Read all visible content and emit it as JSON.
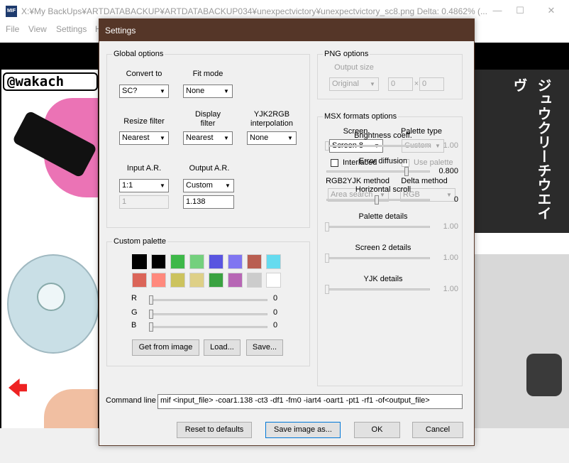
{
  "window": {
    "icon": "MIF",
    "title": "X:¥My BackUps¥ARTDATABACKUP¥ARTDATABACKUP034¥unexpectvictory¥unexpectvictory_sc8.png  Delta: 0.4862% (..."
  },
  "menu": [
    "File",
    "View",
    "Settings",
    "H"
  ],
  "image_overlay": {
    "handle": "@wakach",
    "jp_right": "ジュウクリーチウエイヴ"
  },
  "dialog": {
    "title": "Settings",
    "global": {
      "group_label": "Global options",
      "convert_to": {
        "label": "Convert to",
        "value": "SC?"
      },
      "fit_mode": {
        "label": "Fit mode",
        "value": "None"
      },
      "resize_filter": {
        "label": "Resize filter",
        "value": "Nearest"
      },
      "display_filter": {
        "label": "Display\nfilter",
        "value": "Nearest"
      },
      "yjk2rgb": {
        "label": "YJK2RGB\ninterpolation",
        "value": "None"
      },
      "input_ar": {
        "label": "Input A.R.",
        "value": "1:1",
        "text": "1"
      },
      "output_ar": {
        "label": "Output A.R.",
        "value": "Custom",
        "text": "1.138"
      }
    },
    "png": {
      "group_label": "PNG options",
      "output_size_label": "Output size",
      "output_size_value": "Original",
      "width": "0",
      "times": "×",
      "height": "0"
    },
    "msx": {
      "group_label": "MSX formats options",
      "screen": {
        "label": "Screen",
        "value": "Screen 8"
      },
      "palette_type": {
        "label": "Palette type",
        "value": "Custom"
      },
      "interlaced": "Interlaced",
      "use_palette": "Use palette",
      "rgb2yjk": {
        "label": "RGB2YJK method",
        "value": "Area search"
      },
      "delta": {
        "label": "Delta method",
        "value": "RGB"
      },
      "sliders": [
        {
          "label": "Brightness coeff.",
          "value": "1.00",
          "level": 0.0,
          "enabled": false
        },
        {
          "label": "Error diffusion",
          "value": "0.800",
          "level": 0.8,
          "enabled": true
        },
        {
          "label": "Horizontal scroll",
          "value": "0",
          "level": 0.5,
          "enabled": true
        },
        {
          "label": "Palette details",
          "value": "1.00",
          "level": 0.0,
          "enabled": false
        },
        {
          "label": "Screen 2 details",
          "value": "1.00",
          "level": 0.0,
          "enabled": false
        },
        {
          "label": "YJK details",
          "value": "1.00",
          "level": 0.0,
          "enabled": false
        }
      ]
    },
    "palette": {
      "group_label": "Custom palette",
      "row1": [
        "#000000",
        "#000000",
        "#3eb849",
        "#74d07d",
        "#5955e0",
        "#8076f1",
        "#b95e51",
        "#65dbef"
      ],
      "row2": [
        "#db6559",
        "#ff897d",
        "#ccc35e",
        "#ded087",
        "#3aa241",
        "#b766b5",
        "#cccccc",
        "#ffffff"
      ],
      "rgb": [
        {
          "label": "R",
          "value": "0"
        },
        {
          "label": "G",
          "value": "0"
        },
        {
          "label": "B",
          "value": "0"
        }
      ],
      "get_from_image": "Get from image",
      "load": "Load...",
      "save": "Save..."
    },
    "command_line": {
      "label": "Command line",
      "value": "mif <input_file> -coar1.138 -ct3 -df1 -fm0 -iart4 -oart1 -pt1 -rf1 -of<output_file>"
    },
    "buttons": {
      "reset": "Reset to defaults",
      "save_image": "Save image as...",
      "ok": "OK",
      "cancel": "Cancel"
    }
  }
}
